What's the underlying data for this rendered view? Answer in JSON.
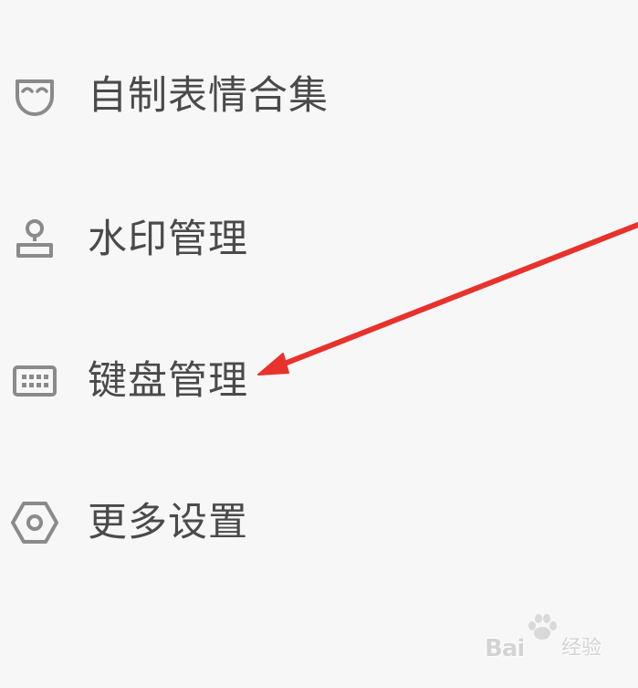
{
  "menu": {
    "items": [
      {
        "label": "自制表情合集",
        "icon": "mask-icon"
      },
      {
        "label": "水印管理",
        "icon": "stamp-icon"
      },
      {
        "label": "键盘管理",
        "icon": "keyboard-icon"
      },
      {
        "label": "更多设置",
        "icon": "hexagon-gear-icon"
      }
    ]
  },
  "annotation": {
    "arrow_color": "#e8322b",
    "target": "键盘管理"
  },
  "watermark": {
    "brand": "Bai",
    "brand_suffix": "经验"
  },
  "colors": {
    "background": "#f7f7f7",
    "text": "#4a4a4a",
    "icon": "#8a8a8a"
  }
}
